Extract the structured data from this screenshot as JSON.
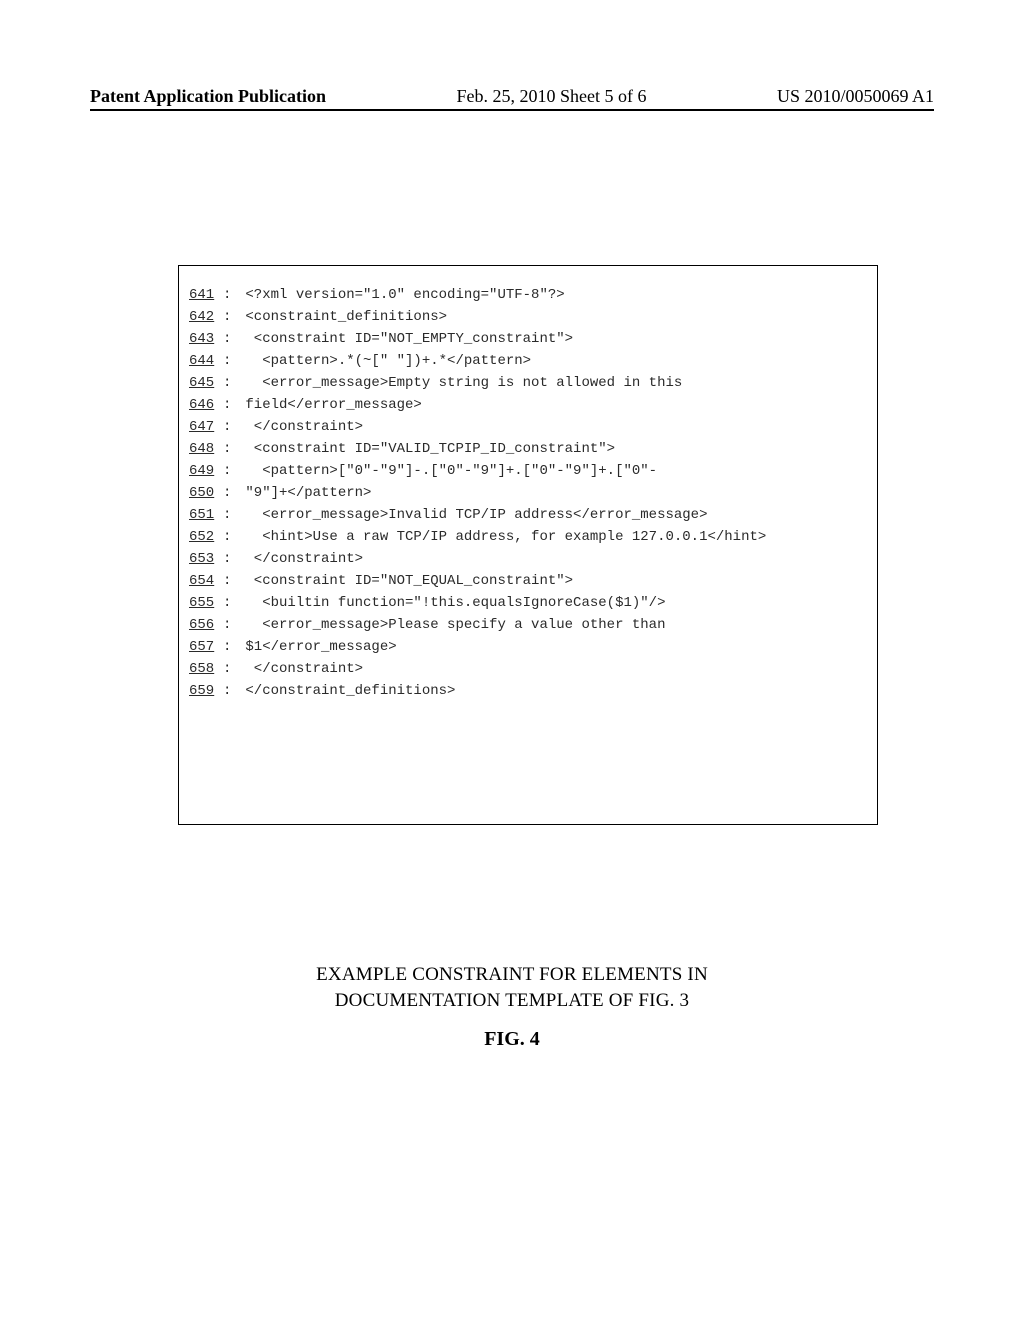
{
  "header": {
    "left": "Patent Application Publication",
    "center": "Feb. 25, 2010  Sheet 5 of 6",
    "right": "US 2010/0050069 A1"
  },
  "code": {
    "lines": [
      {
        "num": "641",
        "text": "<?xml version=\"1.0\" encoding=\"UTF-8\"?>"
      },
      {
        "num": "642",
        "text": "<constraint_definitions>"
      },
      {
        "num": "643",
        "text": " <constraint ID=\"NOT_EMPTY_constraint\">"
      },
      {
        "num": "644",
        "text": "  <pattern>.*(~[\" \"])+.*</pattern>"
      },
      {
        "num": "645",
        "text": "  <error_message>Empty string is not allowed in this"
      },
      {
        "num": "646",
        "text": "field</error_message>"
      },
      {
        "num": "647",
        "text": " </constraint>"
      },
      {
        "num": "648",
        "text": " <constraint ID=\"VALID_TCPIP_ID_constraint\">"
      },
      {
        "num": "649",
        "text": "  <pattern>[\"0\"-\"9\"]-.[\"0\"-\"9\"]+.[\"0\"-\"9\"]+.[\"0\"-"
      },
      {
        "num": "650",
        "text": "\"9\"]+</pattern>"
      },
      {
        "num": "651",
        "text": "  <error_message>Invalid TCP/IP address</error_message>"
      },
      {
        "num": "652",
        "text": "  <hint>Use a raw TCP/IP address, for example 127.0.0.1</hint>"
      },
      {
        "num": "653",
        "text": " </constraint>"
      },
      {
        "num": "654",
        "text": " <constraint ID=\"NOT_EQUAL_constraint\">"
      },
      {
        "num": "655",
        "text": "  <builtin function=\"!this.equalsIgnoreCase($1)\"/>"
      },
      {
        "num": "656",
        "text": "  <error_message>Please specify a value other than"
      },
      {
        "num": "657",
        "text": "$1</error_message>"
      },
      {
        "num": "658",
        "text": " </constraint>"
      },
      {
        "num": "659",
        "text": "</constraint_definitions>"
      }
    ]
  },
  "caption": {
    "line1": "EXAMPLE CONSTRAINT FOR ELEMENTS IN",
    "line2": "DOCUMENTATION TEMPLATE OF FIG. 3"
  },
  "figure_label": "FIG. 4"
}
